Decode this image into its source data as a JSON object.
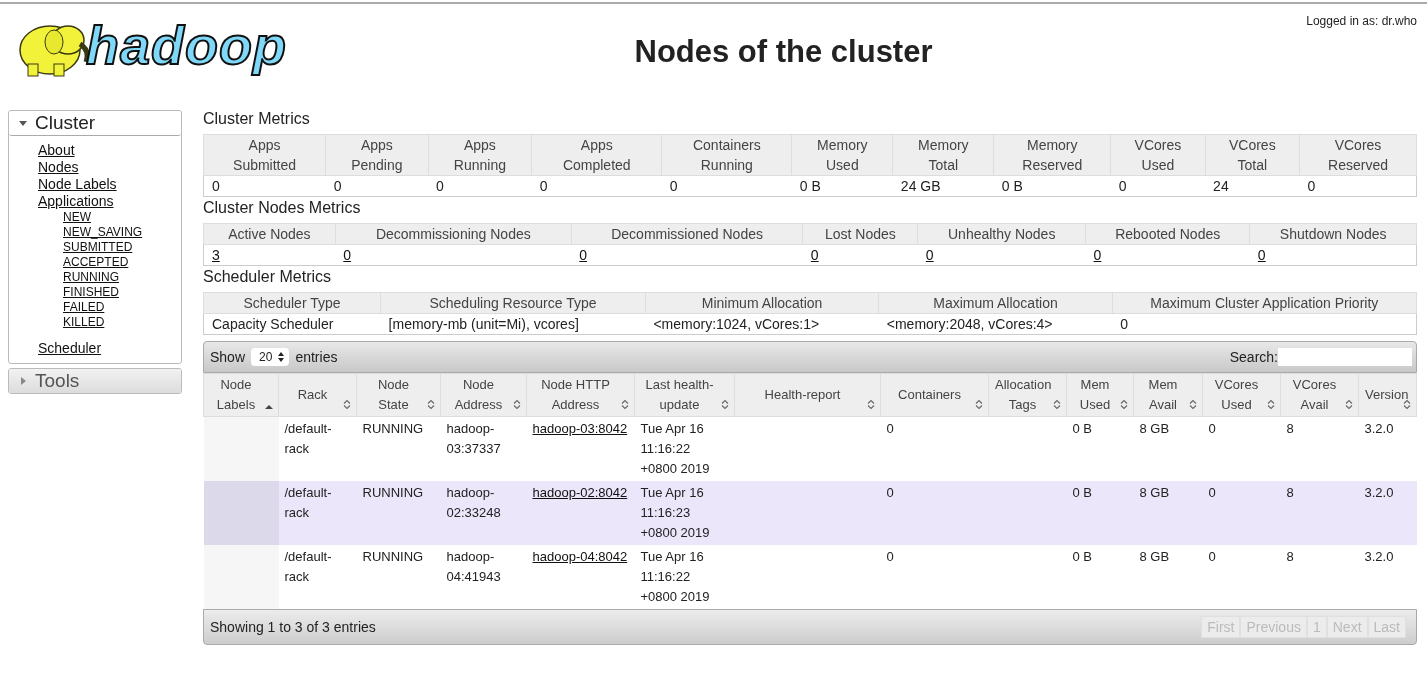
{
  "header": {
    "logo_text": "hadoop",
    "title": "Nodes of the cluster",
    "login": "Logged in as: dr.who"
  },
  "sidebar": [
    {
      "label": "Cluster",
      "expanded": true,
      "items": [
        {
          "label": "About"
        },
        {
          "label": "Nodes"
        },
        {
          "label": "Node Labels"
        },
        {
          "label": "Applications",
          "children": [
            {
              "label": "NEW"
            },
            {
              "label": "NEW_SAVING"
            },
            {
              "label": "SUBMITTED"
            },
            {
              "label": "ACCEPTED"
            },
            {
              "label": "RUNNING"
            },
            {
              "label": "FINISHED"
            },
            {
              "label": "FAILED"
            },
            {
              "label": "KILLED"
            }
          ]
        },
        {
          "label": "Scheduler"
        }
      ]
    },
    {
      "label": "Tools",
      "expanded": false
    }
  ],
  "metrics": [
    {
      "title": "Cluster Metrics",
      "columns": [
        [
          "Apps",
          "Submitted"
        ],
        [
          "Apps",
          "Pending"
        ],
        [
          "Apps",
          "Running"
        ],
        [
          "Apps",
          "Completed"
        ],
        [
          "Containers",
          "Running"
        ],
        [
          "Memory",
          "Used"
        ],
        [
          "Memory",
          "Total"
        ],
        [
          "Memory",
          "Reserved"
        ],
        [
          "VCores",
          "Used"
        ],
        [
          "VCores",
          "Total"
        ],
        [
          "VCores",
          "Reserved"
        ]
      ],
      "values": [
        "0",
        "0",
        "0",
        "0",
        "0",
        "0 B",
        "24 GB",
        "0 B",
        "0",
        "24",
        "0"
      ],
      "kind": "text"
    },
    {
      "title": "Cluster Nodes Metrics",
      "columns": [
        [
          "Active Nodes"
        ],
        [
          "Decommissioning Nodes"
        ],
        [
          "Decommissioned Nodes"
        ],
        [
          "Lost Nodes"
        ],
        [
          "Unhealthy Nodes"
        ],
        [
          "Rebooted Nodes"
        ],
        [
          "Shutdown Nodes"
        ]
      ],
      "values": [
        "3",
        "0",
        "0",
        "0",
        "0",
        "0",
        "0"
      ],
      "kind": "links"
    },
    {
      "title": "Scheduler Metrics",
      "columns": [
        [
          "Scheduler Type"
        ],
        [
          "Scheduling Resource Type"
        ],
        [
          "Minimum Allocation"
        ],
        [
          "Maximum Allocation"
        ],
        [
          "Maximum Cluster Application Priority"
        ]
      ],
      "values": [
        "Capacity Scheduler",
        "[memory-mb (unit=Mi), vcores]",
        "<memory:1024, vCores:1>",
        "<memory:2048, vCores:4>",
        "0"
      ],
      "kind": "text"
    }
  ],
  "nodes_table": {
    "show_label": "Show",
    "page_size": "20",
    "entries_label": "entries",
    "search_label": "Search:",
    "columns": [
      {
        "label": "Node Labels",
        "sorted_ascending": true
      },
      {
        "label": "Rack",
        "sorted_ascending": false
      },
      {
        "label": "Node State",
        "sorted_ascending": false
      },
      {
        "label": "Node Address",
        "sorted_ascending": false
      },
      {
        "label": "Node HTTP Address",
        "sorted_ascending": false
      },
      {
        "label": "Last health-update",
        "sorted_ascending": false
      },
      {
        "label": "Health-report",
        "sorted_ascending": false
      },
      {
        "label": "Containers",
        "sorted_ascending": false
      },
      {
        "label": "Allocation Tags",
        "sorted_ascending": false
      },
      {
        "label": "Mem Used",
        "sorted_ascending": false
      },
      {
        "label": "Mem Avail",
        "sorted_ascending": false
      },
      {
        "label": "VCores Used",
        "sorted_ascending": false
      },
      {
        "label": "VCores Avail",
        "sorted_ascending": false
      },
      {
        "label": "Version",
        "sorted_ascending": false
      }
    ],
    "rows": [
      {
        "selected": false,
        "cells": [
          "",
          "/default-rack",
          "RUNNING",
          "hadoop-03:37337",
          "hadoop-03:8042",
          "Tue Apr 16 11:16:22 +0800 2019",
          "",
          "0",
          "",
          "0 B",
          "8 GB",
          "0",
          "8",
          "3.2.0"
        ]
      },
      {
        "selected": true,
        "cells": [
          "",
          "/default-rack",
          "RUNNING",
          "hadoop-02:33248",
          "hadoop-02:8042",
          "Tue Apr 16 11:16:23 +0800 2019",
          "",
          "0",
          "",
          "0 B",
          "8 GB",
          "0",
          "8",
          "3.2.0"
        ]
      },
      {
        "selected": false,
        "cells": [
          "",
          "/default-rack",
          "RUNNING",
          "hadoop-04:41943",
          "hadoop-04:8042",
          "Tue Apr 16 11:16:22 +0800 2019",
          "",
          "0",
          "",
          "0 B",
          "8 GB",
          "0",
          "8",
          "3.2.0"
        ]
      }
    ],
    "info": "Showing 1 to 3 of 3 entries",
    "pager": [
      {
        "label": "First",
        "disabled": true
      },
      {
        "label": "Previous",
        "disabled": true
      },
      {
        "label": "1",
        "disabled": true
      },
      {
        "label": "Next",
        "disabled": true
      },
      {
        "label": "Last",
        "disabled": true
      }
    ]
  }
}
